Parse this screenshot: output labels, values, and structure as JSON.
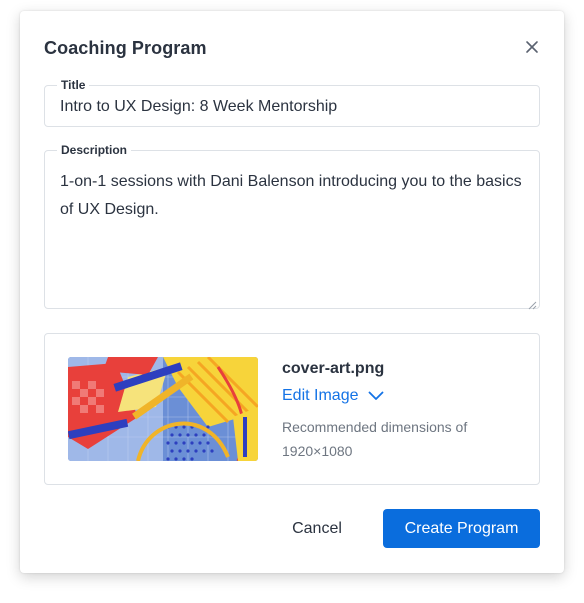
{
  "dialog": {
    "title": "Coaching Program",
    "close_icon": "close-icon"
  },
  "form": {
    "title_field": {
      "label": "Title",
      "value": "Intro to UX Design: 8 Week Mentorship"
    },
    "description_field": {
      "label": "Description",
      "value": "1-on-1 sessions with Dani Balenson introducing you to the basics of UX Design."
    }
  },
  "cover_image": {
    "file_name": "cover-art.png",
    "edit_label": "Edit Image",
    "edit_icon": "chevron-down-icon",
    "hint": "Recommended dimensions of 1920×1080"
  },
  "actions": {
    "cancel_label": "Cancel",
    "create_label": "Create Program"
  },
  "colors": {
    "accent": "#0a6ddd",
    "link": "#1473e6",
    "text": "#2b3340",
    "muted": "#6e7681",
    "border": "#dde1e6"
  }
}
